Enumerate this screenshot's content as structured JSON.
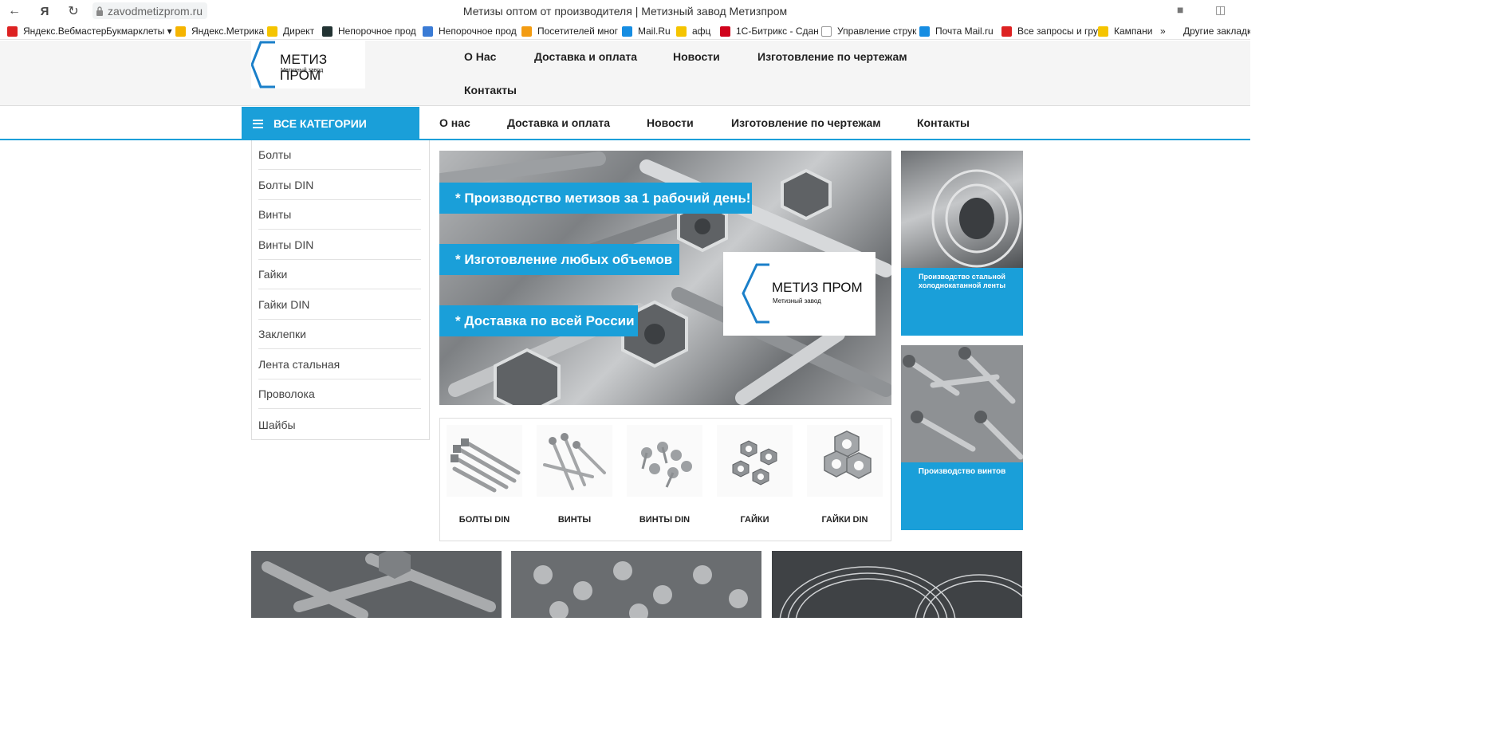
{
  "browser": {
    "url": "zavodmetizprom.ru",
    "window_title": "Метизы оптом от производителя | Метизный завод Метизпром",
    "bookmarks": [
      {
        "label": "Яндекс.Вебмастер",
        "color": "#d22"
      },
      {
        "label": "Букмарклеты ▾",
        "color": ""
      },
      {
        "label": "Яндекс.Метрика",
        "color": "#f5b400"
      },
      {
        "label": "Директ",
        "color": "#f5c400"
      },
      {
        "label": "Непорочное прод",
        "color": "#233"
      },
      {
        "label": "Непорочное прод",
        "color": "#3a7bd5"
      },
      {
        "label": "Посетителей мног",
        "color": "#f39c12"
      },
      {
        "label": "Mail.Ru",
        "color": "#168de2"
      },
      {
        "label": "афц",
        "color": "#f5c400"
      },
      {
        "label": "1С-Битрикс - Сдан",
        "color": "#d0021b"
      },
      {
        "label": "Управление струк",
        "color": "#fff"
      },
      {
        "label": "Почта Mail.ru",
        "color": "#168de2"
      },
      {
        "label": "Все запросы и гру",
        "color": "#d22"
      },
      {
        "label": "Кампани",
        "color": "#f5c400"
      },
      {
        "label": "»",
        "color": ""
      },
      {
        "label": "Другие закладки",
        "color": ""
      }
    ]
  },
  "site": {
    "logo_title": "МЕТИЗ ПРОМ",
    "logo_subtitle": "Метизный завод",
    "top_menu": [
      "О Нас",
      "Доставка и оплата",
      "Новости",
      "Изготовление по чертежам",
      "Контакты"
    ],
    "all_categories_label": "ВСЕ КАТЕГОРИИ",
    "main_nav": [
      "О нас",
      "Доставка и оплата",
      "Новости",
      "Изготовление по чертежам",
      "Контакты"
    ],
    "categories": [
      "Болты",
      "Болты DIN",
      "Винты",
      "Винты DIN",
      "Гайки",
      "Гайки DIN",
      "Заклепки",
      "Лента стальная",
      "Проволока",
      "Шайбы"
    ],
    "hero_tags": [
      "* Производство метизов за 1 рабочий день!",
      "* Изготовление любых объемов",
      "* Доставка по всей России"
    ],
    "products": [
      "БОЛТЫ DIN",
      "ВИНТЫ",
      "ВИНТЫ DIN",
      "ГАЙКИ",
      "ГАЙКИ DIN"
    ],
    "promos": [
      {
        "label": "Производство стальной холоднокатанной ленты"
      },
      {
        "label": "Производство винтов"
      }
    ],
    "accent_color": "#1a9fd9"
  }
}
